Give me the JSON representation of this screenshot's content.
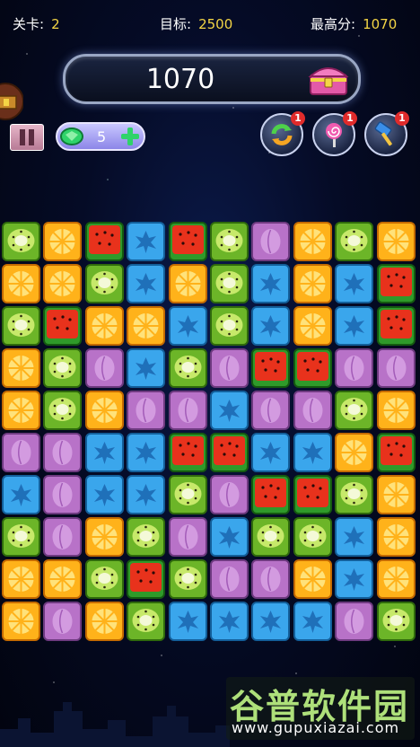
{
  "level": {
    "label": "关卡:",
    "value": "2"
  },
  "target": {
    "label": "目标:",
    "value": "2500"
  },
  "best": {
    "label": "最高分:",
    "value": "1070"
  },
  "score": "1070",
  "gems": {
    "count": "5"
  },
  "tools": [
    {
      "name": "refresh-tool",
      "badge": "1"
    },
    {
      "name": "lollipop-tool",
      "badge": "1"
    },
    {
      "name": "hammer-tool",
      "badge": "1"
    }
  ],
  "board": {
    "rows": [
      [
        "kiwi",
        "orange",
        "watermelon",
        "blueberry",
        "watermelon",
        "kiwi",
        "grape",
        "orange",
        "kiwi",
        "orange"
      ],
      [
        "orange",
        "orange",
        "kiwi",
        "blueberry",
        "orange",
        "kiwi",
        "blueberry",
        "orange",
        "blueberry",
        "watermelon"
      ],
      [
        "kiwi",
        "watermelon",
        "orange",
        "orange",
        "blueberry",
        "kiwi",
        "blueberry",
        "orange",
        "blueberry",
        "watermelon"
      ],
      [
        "orange",
        "kiwi",
        "grape",
        "blueberry",
        "kiwi",
        "grape",
        "watermelon",
        "watermelon",
        "grape",
        "grape"
      ],
      [
        "orange",
        "kiwi",
        "orange",
        "grape",
        "grape",
        "blueberry",
        "grape",
        "grape",
        "kiwi",
        "orange"
      ],
      [
        "grape",
        "grape",
        "blueberry",
        "blueberry",
        "watermelon",
        "watermelon",
        "blueberry",
        "blueberry",
        "orange",
        "watermelon"
      ],
      [
        "blueberry",
        "grape",
        "blueberry",
        "blueberry",
        "kiwi",
        "grape",
        "watermelon",
        "watermelon",
        "kiwi",
        "orange"
      ],
      [
        "kiwi",
        "grape",
        "orange",
        "kiwi",
        "grape",
        "blueberry",
        "kiwi",
        "kiwi",
        "blueberry",
        "orange"
      ],
      [
        "orange",
        "orange",
        "kiwi",
        "watermelon",
        "kiwi",
        "grape",
        "grape",
        "orange",
        "blueberry",
        "orange"
      ],
      [
        "orange",
        "grape",
        "orange",
        "kiwi",
        "blueberry",
        "blueberry",
        "blueberry",
        "blueberry",
        "grape",
        "kiwi"
      ]
    ]
  },
  "watermark": {
    "title": "谷普软件园",
    "url": "www.gupuxiazai.com"
  },
  "colors": {
    "accent_yellow": "#f4d545",
    "kiwi": "#6cb528",
    "orange": "#ffb21a",
    "watermelon": "#e8321c",
    "blueberry": "#3aa6ec",
    "grape": "#b872c8"
  }
}
